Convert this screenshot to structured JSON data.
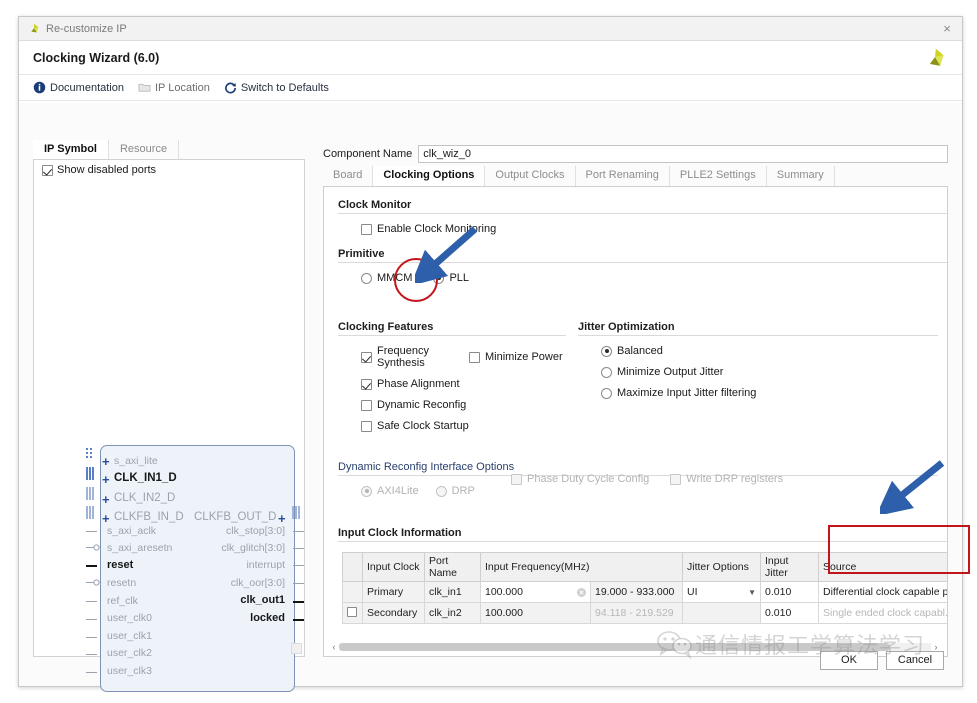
{
  "window": {
    "title": "Re-customize IP",
    "close_label": "×",
    "icon": "xilinx-logo-icon"
  },
  "header": {
    "title": "Clocking Wizard (6.0)",
    "logo": "xilinx-logo-icon"
  },
  "toolbar": {
    "items": [
      {
        "label": "Documentation",
        "icon": "info-icon"
      },
      {
        "label": "IP Location",
        "icon": "folder-icon"
      },
      {
        "label": "Switch to Defaults",
        "icon": "refresh-icon"
      }
    ]
  },
  "left_panel": {
    "tabs": [
      {
        "label": "IP Symbol",
        "active": true
      },
      {
        "label": "Resource",
        "active": false
      }
    ],
    "show_disabled_ports": {
      "label": "Show disabled ports",
      "checked": true
    },
    "symbol": {
      "left_ports": [
        {
          "name": "s_axi_lite",
          "style": "bus",
          "enabled": false
        },
        {
          "name": "CLK_IN1_D",
          "style": "bus",
          "enabled": true
        },
        {
          "name": "CLK_IN2_D",
          "style": "bus",
          "enabled": false
        },
        {
          "name": "CLKFB_IN_D",
          "style": "bus",
          "enabled": false
        },
        {
          "name": "s_axi_aclk",
          "style": "clk",
          "enabled": false
        },
        {
          "name": "s_axi_aresetn",
          "style": "rst",
          "enabled": false
        },
        {
          "name": "reset",
          "style": "pin",
          "enabled": true
        },
        {
          "name": "resetn",
          "style": "rst",
          "enabled": false
        },
        {
          "name": "ref_clk",
          "style": "pin",
          "enabled": false
        },
        {
          "name": "user_clk0",
          "style": "pin",
          "enabled": false
        },
        {
          "name": "user_clk1",
          "style": "pin",
          "enabled": false
        },
        {
          "name": "user_clk2",
          "style": "pin",
          "enabled": false
        },
        {
          "name": "user_clk3",
          "style": "pin",
          "enabled": false
        }
      ],
      "right_ports": [
        {
          "name": "CLKFB_OUT_D",
          "style": "bus",
          "enabled": false
        },
        {
          "name": "clk_stop[3:0]",
          "style": "pin",
          "enabled": false
        },
        {
          "name": "clk_glitch[3:0]",
          "style": "pin",
          "enabled": false
        },
        {
          "name": "interrupt",
          "style": "pin",
          "enabled": false
        },
        {
          "name": "clk_oor[3:0]",
          "style": "pin",
          "enabled": false
        },
        {
          "name": "clk_out1",
          "style": "pin",
          "enabled": true
        },
        {
          "name": "locked",
          "style": "pin",
          "enabled": true
        }
      ]
    }
  },
  "main": {
    "component_name": {
      "label": "Component Name",
      "value": "clk_wiz_0"
    },
    "tabs": [
      {
        "label": "Board",
        "active": false
      },
      {
        "label": "Clocking Options",
        "active": true
      },
      {
        "label": "Output Clocks",
        "active": false
      },
      {
        "label": "Port Renaming",
        "active": false
      },
      {
        "label": "PLLE2 Settings",
        "active": false
      },
      {
        "label": "Summary",
        "active": false
      }
    ],
    "clock_monitor": {
      "title": "Clock Monitor",
      "enable": {
        "label": "Enable Clock Monitoring",
        "checked": false
      }
    },
    "primitive": {
      "title": "Primitive",
      "options": [
        {
          "label": "MMCM",
          "selected": false
        },
        {
          "label": "PLL",
          "selected": true
        }
      ]
    },
    "clocking_features": {
      "title": "Clocking Features",
      "options": [
        {
          "label": "Frequency Synthesis",
          "checked": true
        },
        {
          "label": "Minimize Power",
          "checked": false
        },
        {
          "label": "Phase Alignment",
          "checked": true
        },
        {
          "label": "Dynamic Reconfig",
          "checked": false
        },
        {
          "label": "Safe Clock Startup",
          "checked": false
        }
      ]
    },
    "jitter_optimization": {
      "title": "Jitter Optimization",
      "options": [
        {
          "label": "Balanced",
          "selected": true
        },
        {
          "label": "Minimize Output Jitter",
          "selected": false
        },
        {
          "label": "Maximize Input Jitter filtering",
          "selected": false
        }
      ]
    },
    "dynamic_reconfig": {
      "title": "Dynamic Reconfig Interface Options",
      "radios": [
        {
          "label": "AXI4Lite",
          "selected": true,
          "disabled": true
        },
        {
          "label": "DRP",
          "selected": false,
          "disabled": true
        }
      ],
      "checks": [
        {
          "label": "Phase Duty Cycle Config",
          "checked": false,
          "disabled": true
        },
        {
          "label": "Write DRP registers",
          "checked": false,
          "disabled": true
        }
      ]
    },
    "input_clock_information": {
      "title": "Input Clock Information",
      "columns": [
        "",
        "Input Clock",
        "Port Name",
        "Input Frequency(MHz)",
        "",
        "Jitter Options",
        "Input Jitter",
        "Source"
      ],
      "rows": [
        {
          "checkbox": {
            "visible": false,
            "checked": false
          },
          "input_clock": "Primary",
          "port_name": "clk_in1",
          "input_frequency": "100.000",
          "frequency_range": "19.000 - 933.000",
          "jitter_options": "UI",
          "input_jitter": "0.010",
          "source": "Differential clock capable pin",
          "enabled": true
        },
        {
          "checkbox": {
            "visible": true,
            "checked": false
          },
          "input_clock": "Secondary",
          "port_name": "clk_in2",
          "input_frequency": "100.000",
          "frequency_range": "94.118 - 219.529",
          "jitter_options": "",
          "input_jitter": "0.010",
          "source": "Single ended clock capabl...",
          "enabled": false
        }
      ],
      "hscroll": {
        "left_arrow": "‹",
        "right_arrow": "›"
      }
    }
  },
  "footer": {
    "ok_label": "OK",
    "cancel_label": "Cancel"
  },
  "annotations": {
    "accent_color": "#c2151b",
    "arrow_color": "#2d5faa",
    "circle_target": "PLL radio button",
    "rect_target": "Source column"
  },
  "watermark": {
    "text": "通信情报工学算法学习",
    "icon": "wechat-icon"
  }
}
